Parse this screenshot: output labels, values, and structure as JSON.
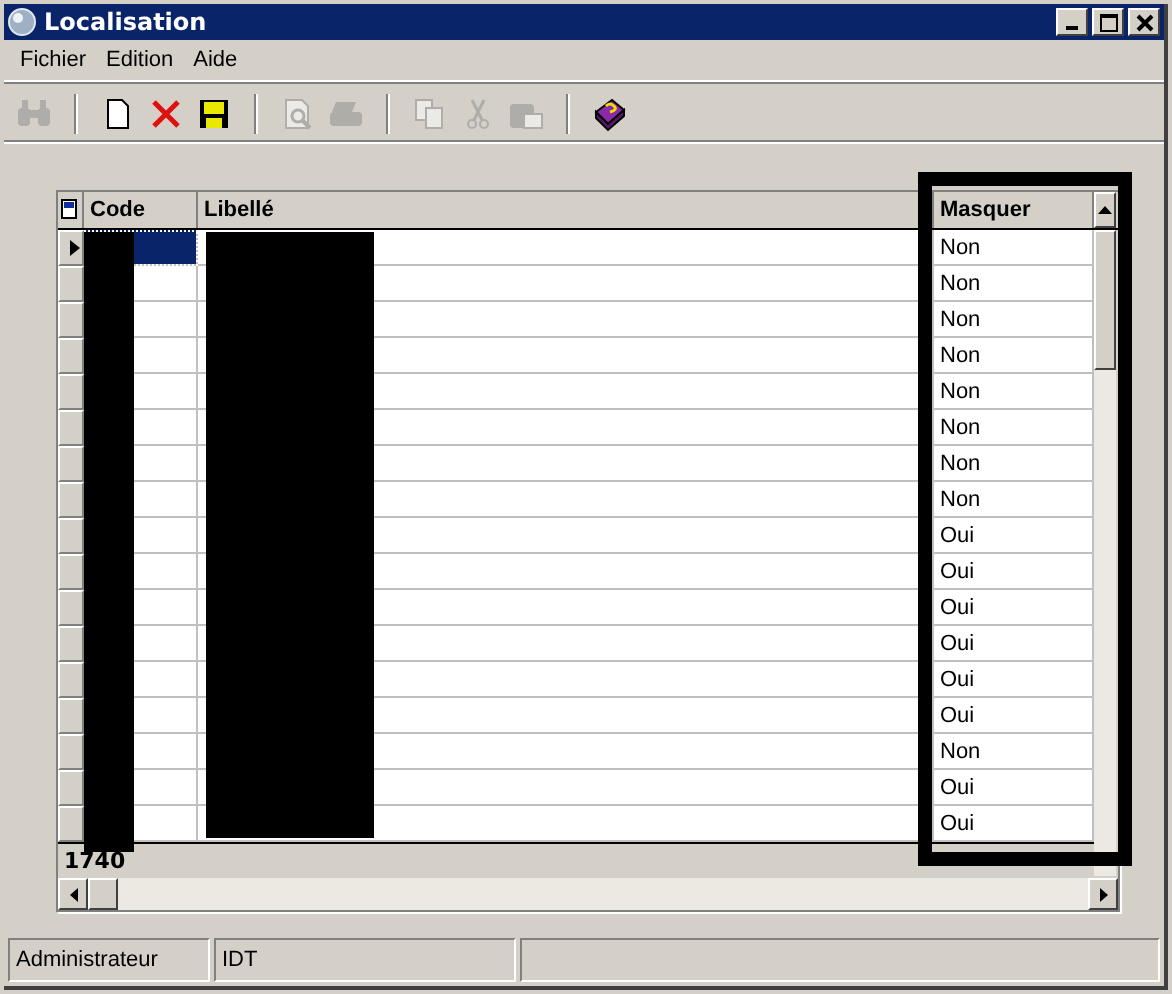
{
  "window": {
    "title": "Localisation"
  },
  "menu": [
    "Fichier",
    "Edition",
    "Aide"
  ],
  "toolbar": [
    {
      "kind": "find",
      "disabled": true
    },
    {
      "kind": "sep"
    },
    {
      "kind": "new",
      "disabled": false
    },
    {
      "kind": "delete",
      "disabled": false
    },
    {
      "kind": "save",
      "disabled": false
    },
    {
      "kind": "sep"
    },
    {
      "kind": "preview",
      "disabled": true
    },
    {
      "kind": "print",
      "disabled": true
    },
    {
      "kind": "sep"
    },
    {
      "kind": "copy",
      "disabled": true
    },
    {
      "kind": "cut",
      "disabled": true
    },
    {
      "kind": "paste",
      "disabled": true
    },
    {
      "kind": "sep"
    },
    {
      "kind": "help",
      "disabled": false
    }
  ],
  "table": {
    "columns": [
      "Code",
      "Libellé",
      "Masquer"
    ],
    "rows": [
      {
        "masquer": "Non",
        "selected": true
      },
      {
        "masquer": "Non",
        "selected": false
      },
      {
        "masquer": "Non",
        "selected": false
      },
      {
        "masquer": "Non",
        "selected": false
      },
      {
        "masquer": "Non",
        "selected": false
      },
      {
        "masquer": "Non",
        "selected": false
      },
      {
        "masquer": "Non",
        "selected": false
      },
      {
        "masquer": "Non",
        "selected": false
      },
      {
        "masquer": "Oui",
        "selected": false
      },
      {
        "masquer": "Oui",
        "selected": false
      },
      {
        "masquer": "Oui",
        "selected": false
      },
      {
        "masquer": "Oui",
        "selected": false
      },
      {
        "masquer": "Oui",
        "selected": false
      },
      {
        "masquer": "Oui",
        "selected": false
      },
      {
        "masquer": "Non",
        "selected": false
      },
      {
        "masquer": "Oui",
        "selected": false
      },
      {
        "masquer": "Oui",
        "selected": false
      }
    ],
    "footer": "1740"
  },
  "status_bar": [
    "Administrateur",
    "IDT"
  ]
}
